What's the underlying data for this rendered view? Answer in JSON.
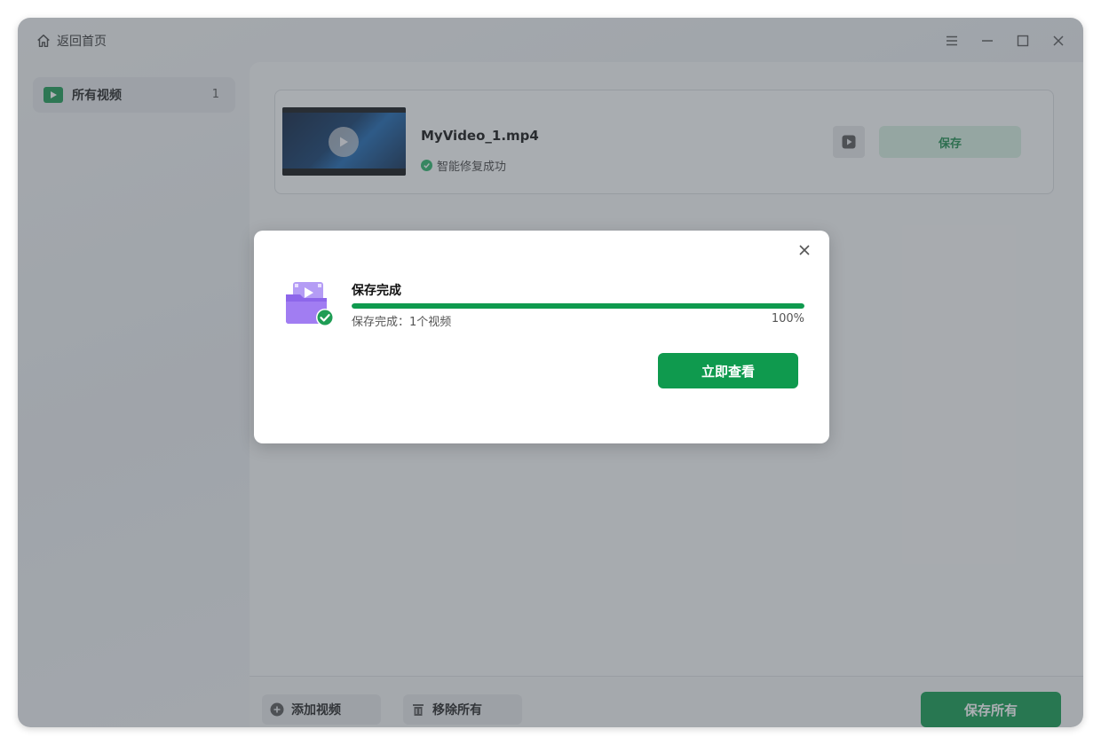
{
  "titlebar": {
    "home_label": "返回首页",
    "icons": [
      "home-icon",
      "menu-icon",
      "minimize-icon",
      "maximize-icon",
      "close-icon"
    ]
  },
  "sidebar": {
    "items": [
      {
        "label": "所有视频",
        "count": "1",
        "icon": "video-play-icon"
      }
    ]
  },
  "main": {
    "videos": [
      {
        "filename": "MyVideo_1.mp4",
        "status": "智能修复成功",
        "save_label": "保存"
      }
    ],
    "footer": {
      "add_label": "添加视频",
      "remove_label": "移除所有",
      "save_all_label": "保存所有"
    }
  },
  "dialog": {
    "title": "保存完成",
    "description": "保存完成：1个视频",
    "percent_text": "100%",
    "progress": 1.0,
    "view_label": "立即查看"
  },
  "colors": {
    "accent": "#0f9a4e",
    "success": "#2bb46a",
    "overlay": "#484e56"
  }
}
